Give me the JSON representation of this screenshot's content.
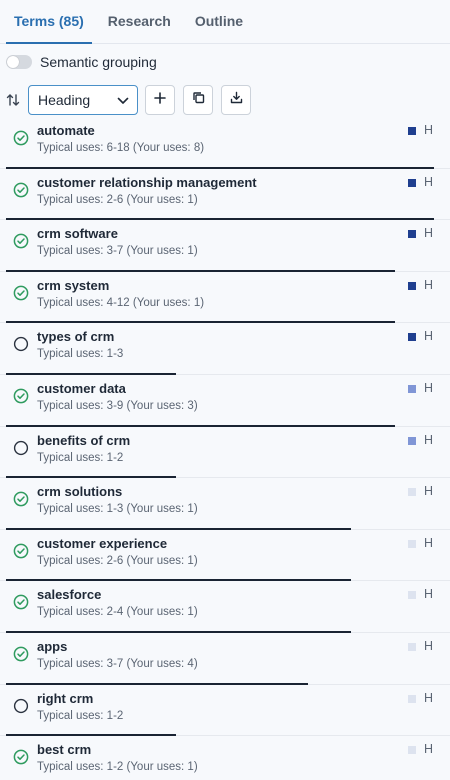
{
  "tabs": [
    {
      "label": "Terms (85)",
      "active": true
    },
    {
      "label": "Research",
      "active": false
    },
    {
      "label": "Outline",
      "active": false
    }
  ],
  "grouping": {
    "label": "Semantic grouping",
    "enabled": false
  },
  "controls": {
    "sort_icon": "sort-arrows-icon",
    "select_value": "Heading",
    "buttons": [
      "plus-icon",
      "copy-icon",
      "download-icon"
    ]
  },
  "colors": {
    "accent": "#2a6fb0",
    "check": "#2f9b5f",
    "swatch_dark": "#1f3f8f",
    "swatch_mid": "#8096d6",
    "swatch_light": "#dde3ef",
    "progress": "#1a2433"
  },
  "terms": [
    {
      "term": "automate",
      "uses": "Typical uses: 6-18 (Your uses: 8)",
      "done": true,
      "level": "dark",
      "h": "H",
      "progress": 0.98
    },
    {
      "term": "customer relationship management",
      "uses": "Typical uses: 2-6 (Your uses: 1)",
      "done": true,
      "level": "dark",
      "h": "H",
      "progress": 0.98
    },
    {
      "term": "crm software",
      "uses": "Typical uses: 3-7 (Your uses: 1)",
      "done": true,
      "level": "dark",
      "h": "H",
      "progress": 0.89
    },
    {
      "term": "crm system",
      "uses": "Typical uses: 4-12 (Your uses: 1)",
      "done": true,
      "level": "dark",
      "h": "H",
      "progress": 0.89
    },
    {
      "term": "types of crm",
      "uses": "Typical uses: 1-3",
      "done": false,
      "level": "dark",
      "h": "H",
      "progress": 0.39
    },
    {
      "term": "customer data",
      "uses": "Typical uses: 3-9 (Your uses: 3)",
      "done": true,
      "level": "mid",
      "h": "H",
      "progress": 0.89
    },
    {
      "term": "benefits of crm",
      "uses": "Typical uses: 1-2",
      "done": false,
      "level": "mid",
      "h": "H",
      "progress": 0.39
    },
    {
      "term": "crm solutions",
      "uses": "Typical uses: 1-3 (Your uses: 1)",
      "done": true,
      "level": "light",
      "h": "H",
      "progress": 0.79
    },
    {
      "term": "customer experience",
      "uses": "Typical uses: 2-6 (Your uses: 1)",
      "done": true,
      "level": "light",
      "h": "H",
      "progress": 0.79
    },
    {
      "term": "salesforce",
      "uses": "Typical uses: 2-4 (Your uses: 1)",
      "done": true,
      "level": "light",
      "h": "H",
      "progress": 0.79
    },
    {
      "term": "apps",
      "uses": "Typical uses: 3-7 (Your uses: 4)",
      "done": true,
      "level": "light",
      "h": "H",
      "progress": 0.69
    },
    {
      "term": "right crm",
      "uses": "Typical uses: 1-2",
      "done": false,
      "level": "light",
      "h": "H",
      "progress": 0.39
    },
    {
      "term": "best crm",
      "uses": "Typical uses: 1-2 (Your uses: 1)",
      "done": true,
      "level": "light",
      "h": "H",
      "progress": 0.3
    }
  ]
}
